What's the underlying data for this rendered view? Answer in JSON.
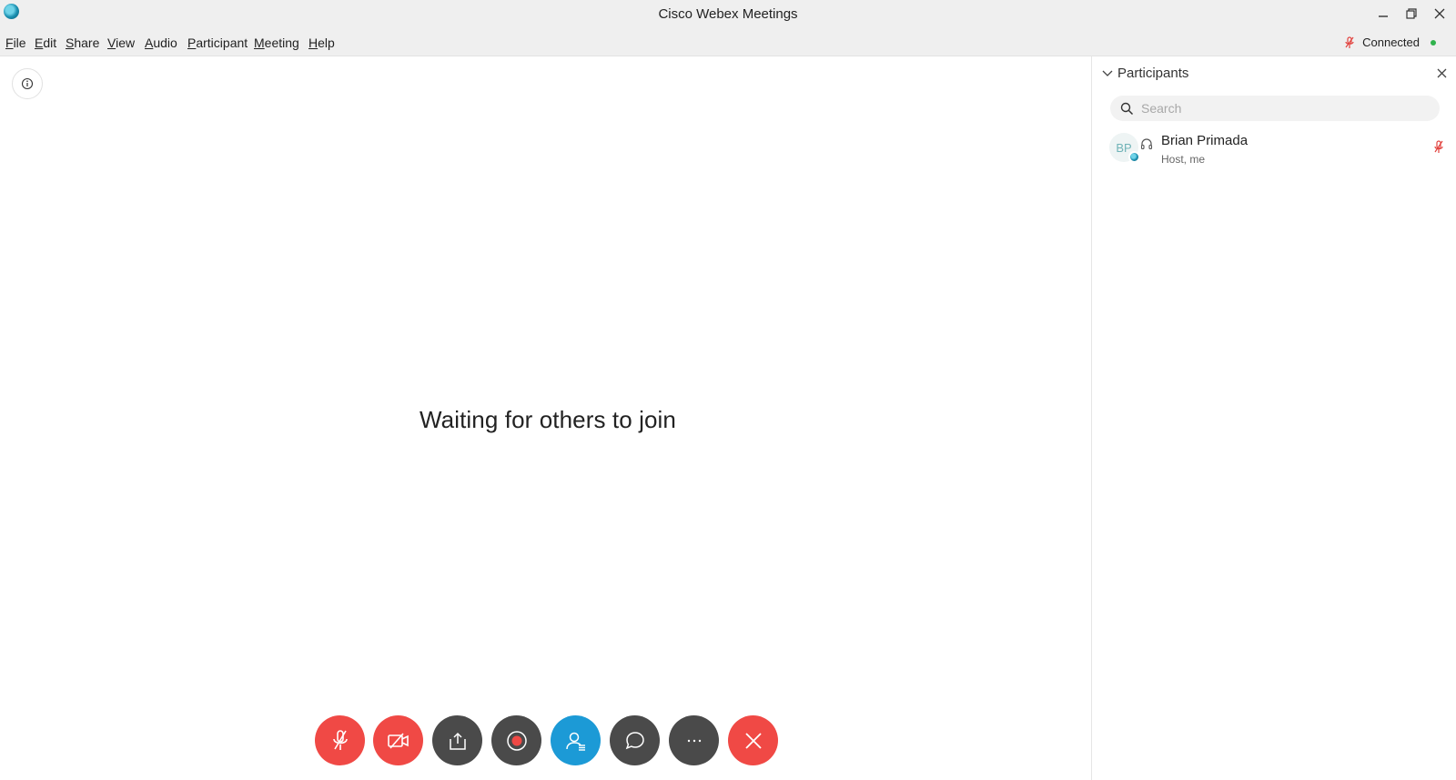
{
  "window": {
    "title": "Cisco Webex Meetings",
    "controls": {
      "minimize": "minimize-icon",
      "restore": "restore-icon",
      "close": "close-icon"
    }
  },
  "menu": [
    "File",
    "Edit",
    "Share",
    "View",
    "Audio",
    "Participant",
    "Meeting",
    "Help"
  ],
  "status": {
    "label": "Connected",
    "mic_state": "muted",
    "dot_color": "#2fb24c"
  },
  "stage": {
    "message": "Waiting for others to join",
    "info_icon": "info-icon"
  },
  "controls": [
    {
      "name": "mute-button",
      "icon": "mic-muted-icon",
      "color": "#f04945"
    },
    {
      "name": "video-button",
      "icon": "video-off-icon",
      "color": "#f04945"
    },
    {
      "name": "share-button",
      "icon": "share-icon",
      "color": "#4a4a4a"
    },
    {
      "name": "record-button",
      "icon": "record-icon",
      "color": "#4a4a4a"
    },
    {
      "name": "participants-button",
      "icon": "participants-icon",
      "color": "#1c9ad6"
    },
    {
      "name": "chat-button",
      "icon": "chat-icon",
      "color": "#4a4a4a"
    },
    {
      "name": "more-button",
      "icon": "more-icon",
      "color": "#4a4a4a"
    },
    {
      "name": "leave-button",
      "icon": "close-icon",
      "color": "#f04945"
    }
  ],
  "participants": {
    "title": "Participants",
    "search_placeholder": "Search",
    "list": [
      {
        "initials": "BP",
        "name": "Brian Primada",
        "role": "Host, me",
        "audio": "headset-icon",
        "mic": "muted"
      }
    ]
  }
}
